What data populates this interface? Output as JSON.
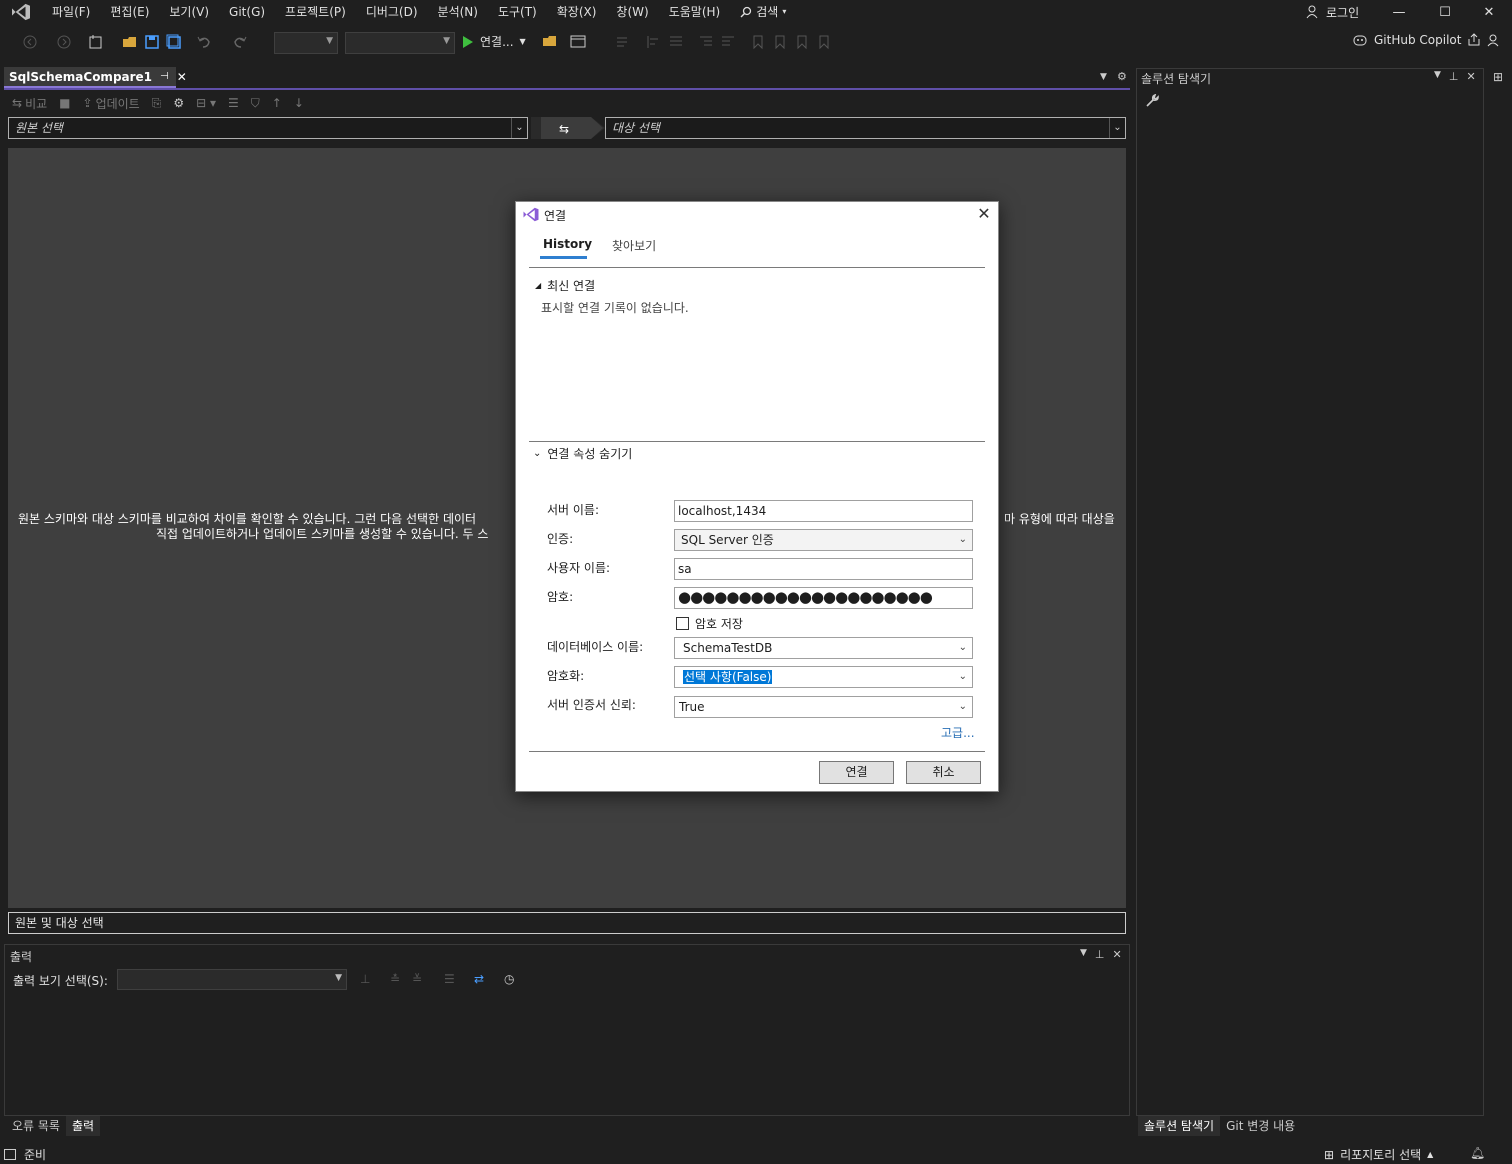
{
  "menu": {
    "items": [
      "파일(F)",
      "편집(E)",
      "보기(V)",
      "Git(G)",
      "프로젝트(P)",
      "디버그(D)",
      "분석(N)",
      "도구(T)",
      "확장(X)",
      "창(W)",
      "도움말(H)"
    ],
    "search": "검색",
    "login": "로그인"
  },
  "toolbar": {
    "run_label": "연결...",
    "copilot": "GitHub Copilot"
  },
  "document": {
    "tab_title": "SqlSchemaCompare1",
    "compare_label": "비교",
    "update_label": "업데이트",
    "source_placeholder": "원본 선택",
    "target_placeholder": "대상 선택",
    "description_line1": "원본 스키마와 대상 스키마를 비교하여 차이를 확인할 수 있습니다. 그런 다음 선택한 데이터",
    "description_line1_right": "마 유형에 따라 대상을",
    "description_line2": "직접 업데이트하거나 업데이트 스키마를 생성할 수 있습니다. 두 스",
    "status_text": "원본 및 대상 선택"
  },
  "output_panel": {
    "title": "출력",
    "view_label": "출력 보기 선택(S):",
    "tabs": [
      "오류 목록",
      "출력"
    ],
    "active_tab": "출력"
  },
  "solution_explorer": {
    "title": "솔루션 탐색기",
    "tabs": [
      "솔루션 탐색기",
      "Git 변경 내용"
    ]
  },
  "statusbar": {
    "ready": "준비",
    "repo": "리포지토리 선택"
  },
  "dialog": {
    "title": "연결",
    "tabs": [
      "History",
      "찾아보기"
    ],
    "active_tab": "History",
    "recent_header": "최신 연결",
    "recent_empty": "표시할 연결 기록이 없습니다.",
    "props_header": "연결 속성 숨기기",
    "fields": {
      "server_label": "서버 이름:",
      "server_value": "localhost,1434",
      "auth_label": "인증:",
      "auth_value": "SQL Server 인증",
      "user_label": "사용자 이름:",
      "user_value": "sa",
      "password_label": "암호:",
      "password_value": "●●●●●●●●●●●●●●●●●●●●●",
      "save_password": "암호 저장",
      "save_password_checked": false,
      "db_label": "데이터베이스 이름:",
      "db_value": "SchemaTestDB",
      "encrypt_label": "암호화:",
      "encrypt_value": "선택 사항(False)",
      "trust_label": "서버 인증서 신뢰:",
      "trust_value": "True"
    },
    "advanced_link": "고급...",
    "connect_button": "연결",
    "cancel_button": "취소"
  },
  "colors": {
    "accent_tab": "#8a78d6",
    "dialog_tab_underline": "#2f7fd0",
    "selection": "#0078d7",
    "run_green": "#3fbf3f"
  }
}
